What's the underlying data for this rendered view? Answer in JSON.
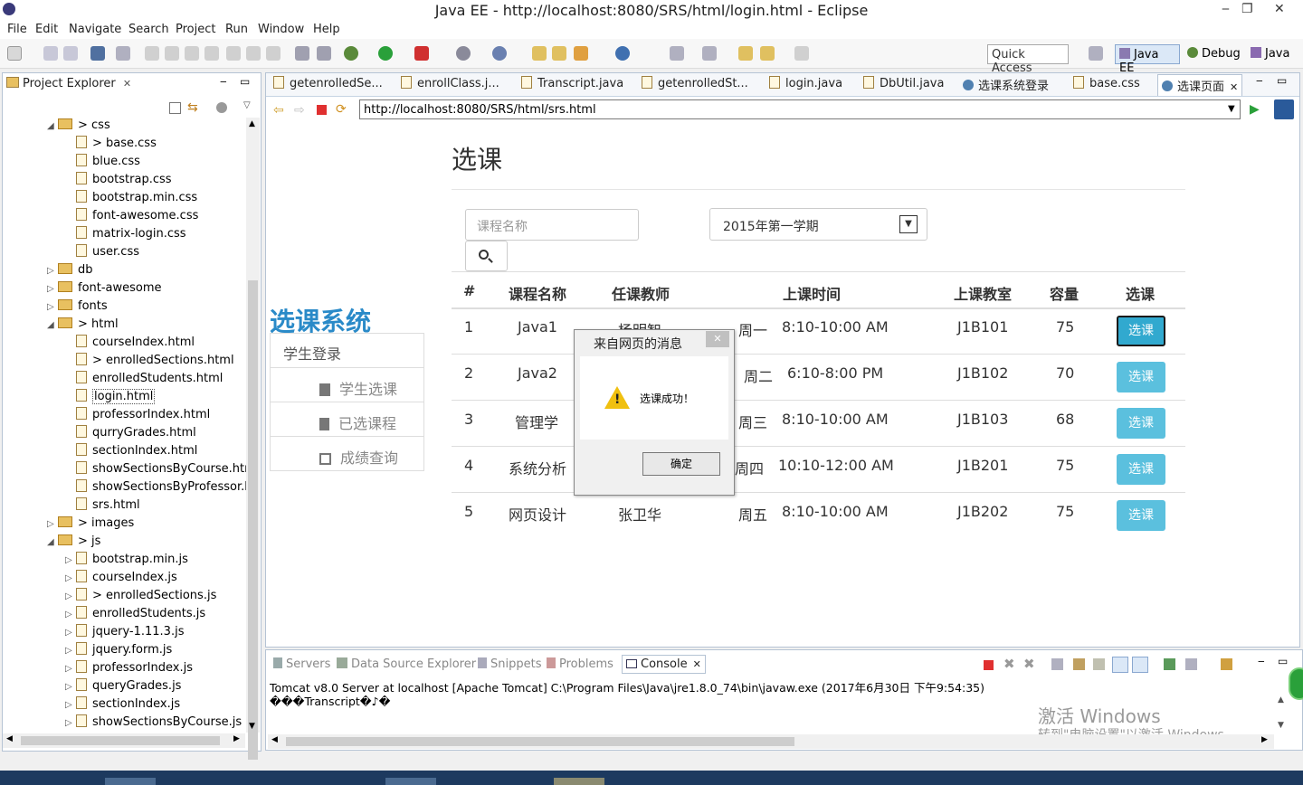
{
  "window": {
    "title": "Java EE - http://localhost:8080/SRS/html/login.html - Eclipse",
    "min": "‒",
    "max": "❐",
    "close": "✕"
  },
  "menu": [
    "File",
    "Edit",
    "Navigate",
    "Search",
    "Project",
    "Run",
    "Window",
    "Help"
  ],
  "toolbar": {
    "quick_access": "Quick Access",
    "perspectives": [
      "Java EE",
      "Debug",
      "Java"
    ]
  },
  "explorer": {
    "title": "Project Explorer",
    "tab_close": "✕",
    "items": [
      {
        "label": "> css",
        "type": "folder",
        "arrow": "◢"
      },
      {
        "label": "> base.css",
        "type": "file"
      },
      {
        "label": "blue.css",
        "type": "file"
      },
      {
        "label": "bootstrap.css",
        "type": "file"
      },
      {
        "label": "bootstrap.min.css",
        "type": "file"
      },
      {
        "label": "font-awesome.css",
        "type": "file"
      },
      {
        "label": "matrix-login.css",
        "type": "file"
      },
      {
        "label": "user.css",
        "type": "file"
      },
      {
        "label": "db",
        "type": "folder",
        "arrow": "▷"
      },
      {
        "label": "font-awesome",
        "type": "folder",
        "arrow": "▷"
      },
      {
        "label": "fonts",
        "type": "folder",
        "arrow": "▷"
      },
      {
        "label": "> html",
        "type": "folder",
        "arrow": "◢"
      },
      {
        "label": "courseIndex.html",
        "type": "file"
      },
      {
        "label": "> enrolledSections.html",
        "type": "file"
      },
      {
        "label": "enrolledStudents.html",
        "type": "file"
      },
      {
        "label": "login.html",
        "type": "file"
      },
      {
        "label": "professorIndex.html",
        "type": "file"
      },
      {
        "label": "qurryGrades.html",
        "type": "file"
      },
      {
        "label": "sectionIndex.html",
        "type": "file"
      },
      {
        "label": "showSectionsByCourse.html",
        "type": "file"
      },
      {
        "label": "showSectionsByProfessor.html",
        "type": "file"
      },
      {
        "label": "srs.html",
        "type": "file"
      },
      {
        "label": "> images",
        "type": "folder",
        "arrow": "▷"
      },
      {
        "label": "> js",
        "type": "folder",
        "arrow": "◢"
      },
      {
        "label": "bootstrap.min.js",
        "type": "jsfile",
        "arrow": "▷"
      },
      {
        "label": "courseIndex.js",
        "type": "jsfile",
        "arrow": "▷"
      },
      {
        "label": "> enrolledSections.js",
        "type": "jsfile",
        "arrow": "▷"
      },
      {
        "label": "enrolledStudents.js",
        "type": "jsfile",
        "arrow": "▷"
      },
      {
        "label": "jquery-1.11.3.js",
        "type": "jsfile",
        "arrow": "▷"
      },
      {
        "label": "jquery.form.js",
        "type": "jsfile",
        "arrow": "▷"
      },
      {
        "label": "professorIndex.js",
        "type": "jsfile",
        "arrow": "▷"
      },
      {
        "label": "queryGrades.js",
        "type": "jsfile",
        "arrow": "▷"
      },
      {
        "label": "sectionIndex.js",
        "type": "jsfile",
        "arrow": "▷"
      },
      {
        "label": "showSectionsByCourse.js",
        "type": "jsfile",
        "arrow": "▷"
      }
    ]
  },
  "editor_tabs": [
    "getenrolledSe...",
    "enrollClass.j...",
    "Transcript.java",
    "getenrolledSt...",
    "login.java",
    "DbUtil.java",
    "选课系统登录",
    "base.css",
    "选课页面"
  ],
  "browser": {
    "url": "http://localhost:8080/SRS/html/srs.html"
  },
  "page": {
    "title": "选课",
    "brand": "选课系统",
    "nav": [
      "学生登录",
      "学生选课",
      "已选课程",
      "成绩查询"
    ],
    "search_placeholder": "课程名称",
    "term": "2015年第一学期",
    "headers": [
      "#",
      "课程名称",
      "任课教师",
      "上课时间",
      "上课教室",
      "容量",
      "选课"
    ],
    "rows": [
      {
        "no": "1",
        "course": "Java1",
        "teacher": "杨明智",
        "day": "周一",
        "time": "8:10-10:00 AM",
        "room": "J1B101",
        "cap": "75",
        "action": "选课"
      },
      {
        "no": "2",
        "course": "Java2",
        "teacher": "",
        "day": "周二",
        "time": "6:10-8:00 PM",
        "room": "J1B102",
        "cap": "70",
        "action": "选课"
      },
      {
        "no": "3",
        "course": "管理学",
        "teacher": "",
        "day": "周三",
        "time": "8:10-10:00 AM",
        "room": "J1B103",
        "cap": "68",
        "action": "选课"
      },
      {
        "no": "4",
        "course": "系统分析",
        "teacher": "",
        "day": "周四",
        "time": "10:10-12:00 AM",
        "room": "J1B201",
        "cap": "75",
        "action": "选课"
      },
      {
        "no": "5",
        "course": "网页设计",
        "teacher": "张卫华",
        "day": "周五",
        "time": "8:10-10:00 AM",
        "room": "J1B202",
        "cap": "75",
        "action": "选课"
      }
    ]
  },
  "dialog": {
    "title": "来自网页的消息",
    "message": "选课成功！",
    "ok": "确定",
    "close": "✕"
  },
  "console": {
    "tabs": [
      "Servers",
      "Data Source Explorer",
      "Snippets",
      "Problems",
      "Console"
    ],
    "server_line": "Tomcat v8.0 Server at localhost [Apache Tomcat] C:\\Program Files\\Java\\jre1.8.0_74\\bin\\javaw.exe (2017年6月30日 下午9:54:35)",
    "output": "���Transcript�♪�",
    "watermark_1": "激活 Windows",
    "watermark_2": "转到\"电脑设置\"以激活 Windows。"
  },
  "colors": {
    "btn": "#5bc0de",
    "brand": "#2a8ac8"
  }
}
